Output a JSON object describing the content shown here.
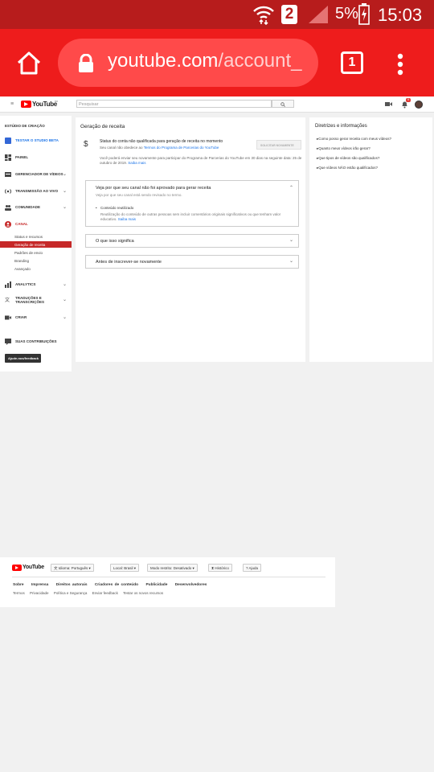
{
  "status_bar": {
    "battery": "5%",
    "time": "15:03",
    "sim_badge": "2"
  },
  "browser": {
    "url_host": "youtube.com",
    "url_path": "/account_",
    "tab_count": "1"
  },
  "yt_header": {
    "logo_text": "YouTube",
    "logo_suffix": "BR",
    "search_placeholder": "Pesquisar",
    "notification_count": "9"
  },
  "sidebar": {
    "section_title": "ESTÚDIO DE CRIAÇÃO",
    "beta": "TESTAR O STUDIO BETA",
    "items": [
      {
        "label": "PAINEL"
      },
      {
        "label": "GERENCIADOR DE VÍDEOS"
      },
      {
        "label": "TRANSMISSÃO AO VIVO"
      },
      {
        "label": "COMUNIDADE"
      },
      {
        "label": "CANAL"
      }
    ],
    "canal_sub": [
      "Status e recursos",
      "Geração de receita",
      "Padrões de envio",
      "Branding",
      "Avançado"
    ],
    "items2": [
      {
        "label": "ANALYTICS"
      },
      {
        "label": "TRADUÇÕES E TRANSCRIÇÕES"
      },
      {
        "label": "CRIAR"
      },
      {
        "label": "SUAS CONTRIBUIÇÕES"
      }
    ],
    "feedback": "Ajude-nos/feedback"
  },
  "main": {
    "title": "Geração de receita",
    "status_title": "Status do conta não qualificada para geração de receita no momento",
    "status_line_prefix": "Seu canal não obedece ao ",
    "status_link": "Termos do Programa de Parcerias do YouTube",
    "button_label": "SOLICITAR NOVAMENTE",
    "reapply_text": "Você poderá enviar seu novamente para participar do Programa de Parcerias do YouTube em 30 dias na seguinte data: 25 de outubro de 2019.",
    "reapply_link": "Saiba mais",
    "panel1_title": "Veja por que seu canal não foi aprovado para gerar receita",
    "panel1_sub": "Veja por que seu canal está sendo revisado no termo.",
    "bullet_title": "Conteúdo reutilizado",
    "bullet_text": "Reutilização do conteúdo de outras pessoas sem incluir comentários originais significativos ou que tenham valor educativo.",
    "bullet_link": "Saiba mais",
    "panel2_title": "O que isso significa",
    "panel3_title": "Antes de inscrever-se novamente"
  },
  "right": {
    "title": "Diretrizes e informações",
    "links": [
      "Como posso gerar receita com meus vídeos?",
      "Quanto meus vídeos irão gerar?",
      "Que tipos de vídeos são qualificados?",
      "Que vídeos NÃO estão qualificados?"
    ]
  },
  "footer": {
    "logo_text": "YouTube",
    "language": "Idioma: Português",
    "location": "Local: Brasil",
    "restricted": "Modo restrito: Desativado",
    "history": "Histórico",
    "help": "Ajuda",
    "links1": [
      "Sobre",
      "Imprensa",
      "Direitos autorais",
      "Criadores de conteúdo",
      "Publicidade",
      "Desenvolvedores"
    ],
    "links2": [
      "Termos",
      "Privacidade",
      "Política e Segurança",
      "Enviar feedback",
      "Testar os novos recursos"
    ]
  },
  "colors": {
    "statusbar": "#b71c1c",
    "toolbar": "#ee1c1c",
    "yt_red": "#ff0000",
    "link_blue": "#1a73e8",
    "active_row": "#c62828"
  }
}
